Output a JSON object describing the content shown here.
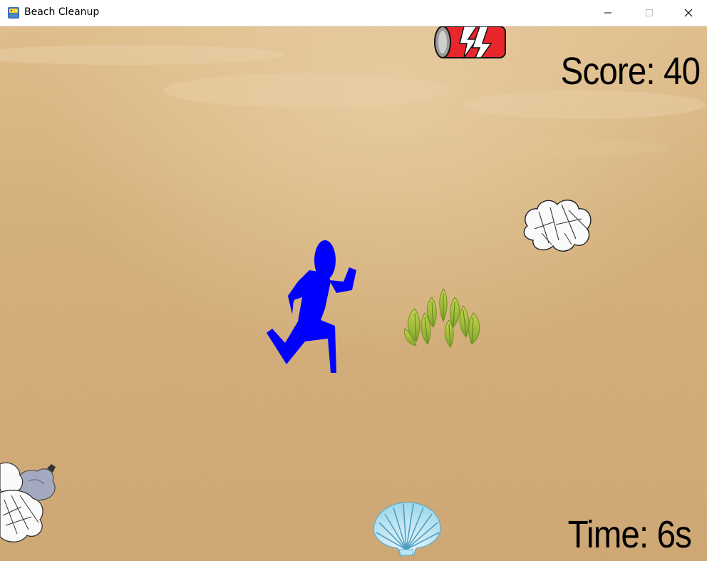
{
  "window": {
    "title": "Beach Cleanup",
    "controls": {
      "minimize": "minimize",
      "maximize": "maximize",
      "close": "close"
    }
  },
  "hud": {
    "score_label": "Score: 40",
    "score_value": 40,
    "time_label": "Time: 6s",
    "time_value_seconds": 6
  },
  "colors": {
    "sand": "#dcb783",
    "player": "#0000ff",
    "can": "#e8262b",
    "seaweed": "#a6c23a",
    "shell": "#8fd3e8",
    "text": "#000000"
  },
  "objects": [
    {
      "kind": "soda-can",
      "icon": "soda-can-icon"
    },
    {
      "kind": "crumpled-paper",
      "icon": "crumpled-paper-icon"
    },
    {
      "kind": "seaweed",
      "icon": "seaweed-icon"
    },
    {
      "kind": "seashell",
      "icon": "seashell-icon"
    },
    {
      "kind": "trash-bag",
      "icon": "trash-bag-icon"
    },
    {
      "kind": "player",
      "icon": "running-person-icon"
    }
  ]
}
